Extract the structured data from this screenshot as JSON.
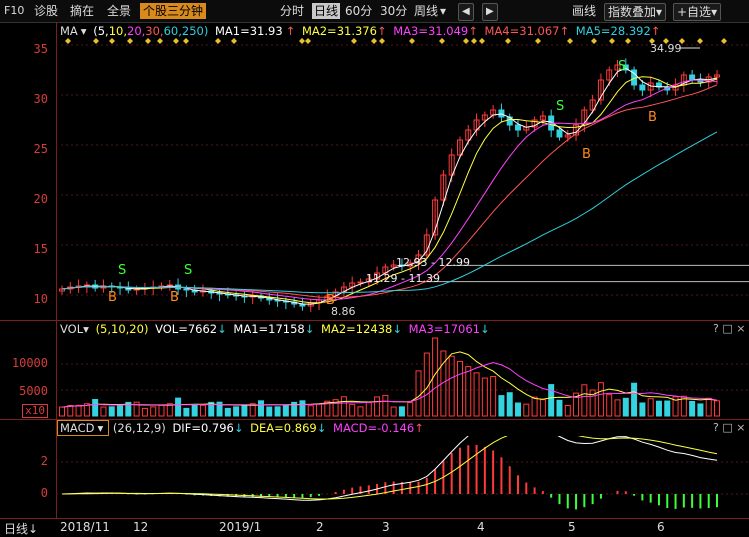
{
  "toolbar": {
    "f10": "F10",
    "items": [
      "诊股",
      "摘在",
      "全景"
    ],
    "active_tab": "个股三分钟",
    "periods": [
      "分时",
      "日线",
      "60分",
      "30分",
      "周线"
    ],
    "selected_period": "日线",
    "dropdown_arrow": "▾",
    "prev": "◀",
    "next": "▶",
    "draw": "画线",
    "overlay": "指数叠加",
    "add": "+自选"
  },
  "main_legend": {
    "name": "MA",
    "params_prefix": "(5,",
    "p10": "10,",
    "p20": "20,",
    "p30": "30,",
    "p60": "60,",
    "p250": "250)",
    "ma1": "MA1=31.93",
    "ma2": "MA2=31.376",
    "ma3": "MA3=31.049",
    "ma4": "MA4=31.067",
    "ma5": "MA5=28.392",
    "up": "↑"
  },
  "main_axis": [
    "35",
    "30",
    "25",
    "20",
    "15",
    "10"
  ],
  "annotations": {
    "high": "34.99",
    "low": "8.86",
    "level1": "12.93 - 12.99",
    "level2": "11.29 - 11.39",
    "buy": "B",
    "sell": "S"
  },
  "vol_legend": {
    "name": "VOL",
    "params": "(5,10,20)",
    "vol": "VOL=7662",
    "ma1": "MA1=17158",
    "ma2": "MA2=12438",
    "ma3": "MA3=17061",
    "down": "↓",
    "up": "↑"
  },
  "vol_axis": [
    "10000",
    "5000"
  ],
  "vol_unit": "x10",
  "macd_legend": {
    "name": "MACD",
    "params": "(26,12,9)",
    "dif": "DIF=0.796",
    "dea": "DEA=0.869",
    "macd": "MACD=-0.146",
    "down": "↓",
    "up": "↑"
  },
  "macd_axis": [
    "2",
    "0"
  ],
  "panel_controls": {
    "help": "?",
    "max": "□",
    "close": "×"
  },
  "xaxis": {
    "mode": "日线",
    "mode_arrow": "↓",
    "labels": [
      "2018/11",
      "12",
      "2019/1",
      "2",
      "3",
      "4",
      "5",
      "6"
    ]
  },
  "colors": {
    "up": "#ff3b3b",
    "down": "#34d3e0",
    "ma1": "#ffffff",
    "ma2": "#ffff40",
    "ma3": "#ff40ff",
    "ma4": "#ff5555",
    "ma5": "#2fd0e0",
    "accent": "#d98a1c"
  },
  "chart_data": {
    "type": "candlestick",
    "ylim": [
      8,
      36
    ],
    "x": [
      "2018/11",
      "12",
      "2019/1",
      "2",
      "3",
      "4",
      "5",
      "6"
    ],
    "close": [
      10.6,
      10.8,
      10.9,
      11.0,
      10.7,
      10.9,
      10.8,
      10.7,
      10.5,
      10.6,
      10.7,
      10.8,
      10.9,
      11.0,
      10.6,
      10.5,
      10.3,
      10.4,
      10.2,
      10.1,
      10.0,
      9.9,
      9.8,
      9.9,
      9.7,
      9.5,
      9.4,
      9.3,
      9.1,
      8.9,
      9.2,
      9.5,
      9.9,
      10.3,
      10.8,
      11.2,
      11.3,
      11.6,
      12.2,
      12.8,
      13.0,
      12.9,
      13.2,
      14.0,
      16.0,
      19.5,
      22.0,
      24.0,
      25.5,
      26.5,
      27.5,
      28.0,
      28.5,
      27.8,
      27.0,
      26.5,
      26.8,
      27.5,
      27.9,
      26.5,
      25.8,
      26.0,
      27.0,
      28.5,
      29.5,
      31.5,
      32.5,
      33.0,
      32.5,
      31.0,
      30.5,
      31.2,
      30.8,
      30.5,
      31.0,
      32.0,
      31.5,
      31.3,
      31.8,
      32.0
    ],
    "volume_max": 15000,
    "macd_ylim": [
      -2,
      4
    ]
  }
}
